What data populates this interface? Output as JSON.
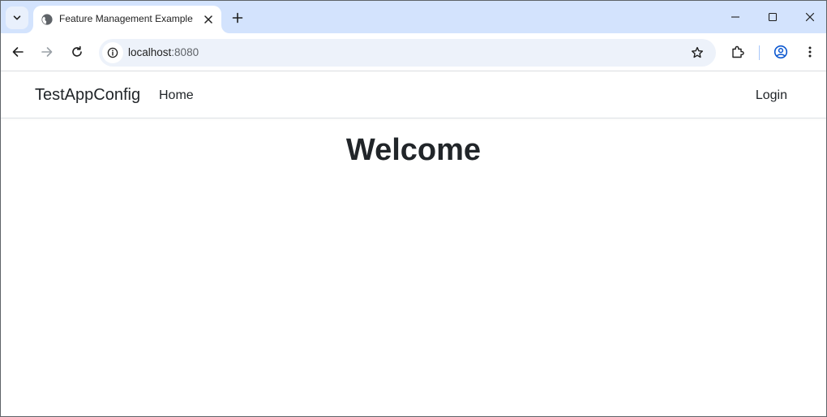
{
  "browser": {
    "tab": {
      "title": "Feature Management Example",
      "favicon": "globe-icon"
    },
    "address_bar": {
      "host": "localhost",
      "port": ":8080"
    },
    "icons": {
      "tab_search": "chevron-down-icon",
      "close_tab": "close-icon",
      "new_tab": "plus-icon",
      "minimize": "minimize-icon",
      "maximize": "maximize-icon",
      "close_window": "close-icon",
      "back": "arrow-left-icon",
      "forward": "arrow-right-icon",
      "reload": "reload-icon",
      "site_info": "info-icon",
      "bookmark": "star-icon",
      "extensions": "puzzle-icon",
      "profile": "account-icon",
      "menu": "kebab-menu-icon"
    },
    "colors": {
      "tabstrip": "#d3e3fd",
      "omnibox": "#edf2fa",
      "profile_accent": "#0b57d0"
    }
  },
  "page": {
    "navbar": {
      "brand": "TestAppConfig",
      "links": [
        "Home"
      ],
      "login": "Login"
    },
    "heading": "Welcome"
  }
}
